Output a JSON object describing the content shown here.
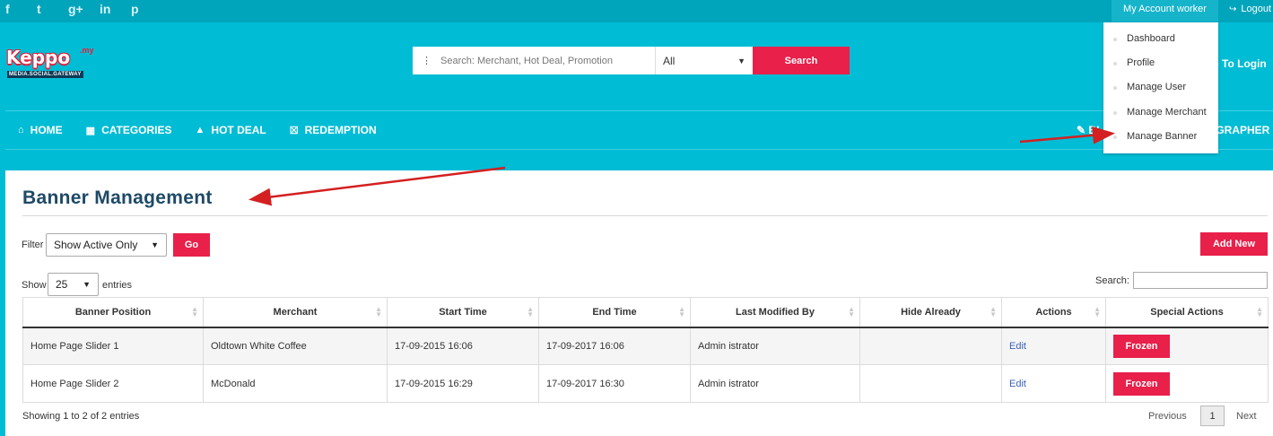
{
  "topbar": {
    "social_icons": [
      {
        "name": "facebook-icon",
        "glyph": "f"
      },
      {
        "name": "twitter-icon",
        "glyph": "t"
      },
      {
        "name": "google-plus-icon",
        "glyph": "g+"
      },
      {
        "name": "linkedin-icon",
        "glyph": "in"
      },
      {
        "name": "pinterest-icon",
        "glyph": "p"
      }
    ],
    "account_label": "My Account worker",
    "logout_label": "Logout"
  },
  "logo": {
    "main": "Keppo",
    "sup": ".my",
    "tagline": "MEDIA.SOCIAL.GATEWAY"
  },
  "search": {
    "placeholder": "Search: Merchant, Hot Deal, Promotion",
    "category": "All",
    "button": "Search"
  },
  "header_right_text": "e To Login",
  "nav": {
    "home": "HOME",
    "categories": "CATEGORIES",
    "hot_deal": "HOT DEAL",
    "redemption": "REDEMPTION",
    "right_partial_1": "BL",
    "right_partial_2": "OGRAPHER"
  },
  "account_menu": [
    "Dashboard",
    "Profile",
    "Manage User",
    "Manage Merchant",
    "Manage Banner"
  ],
  "page": {
    "title": "Banner Management",
    "filter_label": "Filter",
    "filter_value": "Show Active Only",
    "go_button": "Go",
    "add_new_button": "Add New",
    "show_label": "Show",
    "show_value": "25",
    "entries_label": "entries",
    "search_label": "Search:",
    "info": "Showing 1 to 2 of 2 entries",
    "pagination": {
      "previous": "Previous",
      "current": "1",
      "next": "Next"
    }
  },
  "table": {
    "headers": [
      "Banner Position",
      "Merchant",
      "Start Time",
      "End Time",
      "Last Modified By",
      "Hide Already",
      "Actions",
      "Special Actions"
    ],
    "rows": [
      {
        "position": "Home Page Slider 1",
        "merchant": "Oldtown White Coffee",
        "start": "17-09-2015 16:06",
        "end": "17-09-2017 16:06",
        "modified_by": "Admin istrator",
        "hide": "",
        "action": "Edit",
        "special": "Frozen"
      },
      {
        "position": "Home Page Slider 2",
        "merchant": "McDonald",
        "start": "17-09-2015 16:29",
        "end": "17-09-2017 16:30",
        "modified_by": "Admin istrator",
        "hide": "",
        "action": "Edit",
        "special": "Frozen"
      }
    ]
  },
  "colors": {
    "header_bg": "#00bcd4",
    "topbar_bg": "#00a5bb",
    "accent_red": "#e8204a",
    "title_color": "#1e4a66",
    "annotation_arrow": "#d42020"
  }
}
